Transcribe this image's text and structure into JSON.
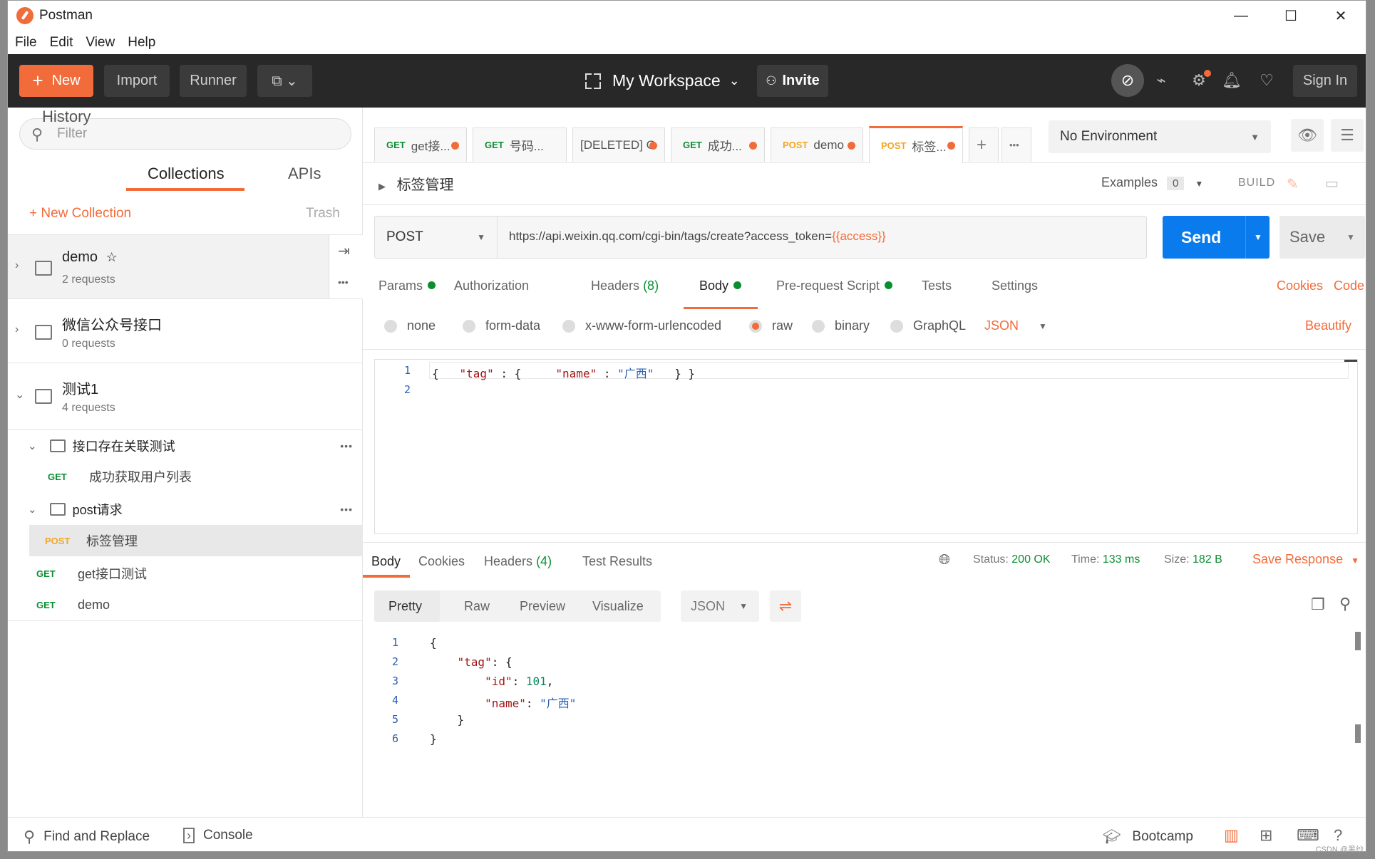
{
  "window": {
    "title": "Postman",
    "controls": [
      "minimize-icon",
      "maximize-icon",
      "close-icon"
    ]
  },
  "menu": [
    "File",
    "Edit",
    "View",
    "Help"
  ],
  "header": {
    "new_label": "New",
    "import_label": "Import",
    "runner_label": "Runner",
    "workspace_label": "My Workspace",
    "invite_label": "Invite",
    "signin_label": "Sign In",
    "icons": [
      "sync-off-icon",
      "satellite-icon",
      "settings-icon",
      "bell-icon",
      "heart-icon"
    ],
    "accent": "#f26b3a"
  },
  "sidebar": {
    "filter_placeholder": "Filter",
    "tabs": [
      "History",
      "Collections",
      "APIs"
    ],
    "active_tab": "Collections",
    "new_collection_label": "+ New Collection",
    "trash_label": "Trash",
    "collections": [
      {
        "name": "demo",
        "sub": "2 requests",
        "starred": true
      },
      {
        "name": "微信公众号接口",
        "sub": "0 requests"
      },
      {
        "name": "测试1",
        "sub": "4 requests",
        "expanded": true
      }
    ],
    "tree": [
      {
        "type": "folder",
        "name": "接口存在关联测试"
      },
      {
        "type": "request",
        "method": "GET",
        "name": "成功获取用户列表"
      },
      {
        "type": "folder",
        "name": "post请求"
      },
      {
        "type": "request",
        "method": "POST",
        "name": "标签管理",
        "selected": true
      },
      {
        "type": "request",
        "method": "GET",
        "name": "get接口测试"
      },
      {
        "type": "request",
        "method": "GET",
        "name": "demo"
      }
    ]
  },
  "request_tabs": [
    {
      "method": "GET",
      "name": "get接..."
    },
    {
      "method": "GET",
      "name": "号码..."
    },
    {
      "method": "",
      "name": "[DELETED]  G"
    },
    {
      "method": "GET",
      "name": "成功..."
    },
    {
      "method": "POST",
      "name": "demo"
    },
    {
      "method": "POST",
      "name": "标签...",
      "active": true
    }
  ],
  "environment": {
    "selected": "No Environment"
  },
  "request": {
    "name": "标签管理",
    "examples_label": "Examples",
    "examples_count": "0",
    "build_label": "BUILD",
    "method": "POST",
    "url_prefix": "https://api.weixin.qq.com/cgi-bin/tags/create?access_token=",
    "url_var": "{{access}}",
    "send_label": "Send",
    "save_label": "Save",
    "tabs": {
      "params": "Params",
      "authorization": "Authorization",
      "headers": "Headers",
      "headers_count": "(8)",
      "body": "Body",
      "prerequest": "Pre-request Script",
      "tests": "Tests",
      "settings": "Settings"
    },
    "cookies_label": "Cookies",
    "code_label": "Code",
    "body_options": [
      "none",
      "form-data",
      "x-www-form-urlencoded",
      "raw",
      "binary",
      "GraphQL"
    ],
    "body_selected": "raw",
    "body_format": "JSON",
    "beautify_label": "Beautify",
    "body_lines": [
      "1",
      "2"
    ]
  },
  "response": {
    "tabs": {
      "body": "Body",
      "cookies": "Cookies",
      "headers": "Headers",
      "headers_count": "(4)",
      "tests": "Test Results"
    },
    "status_label": "Status:",
    "status_value": "200 OK",
    "time_label": "Time:",
    "time_value": "133 ms",
    "size_label": "Size:",
    "size_value": "182 B",
    "save_response_label": "Save Response",
    "view_modes": [
      "Pretty",
      "Raw",
      "Preview",
      "Visualize"
    ],
    "active_view": "Pretty",
    "format": "JSON",
    "lines": [
      "1",
      "2",
      "3",
      "4",
      "5",
      "6"
    ]
  },
  "footer": {
    "find_replace": "Find and Replace",
    "console": "Console",
    "bootcamp": "Bootcamp",
    "watermark": "CSDN @黑纱"
  }
}
